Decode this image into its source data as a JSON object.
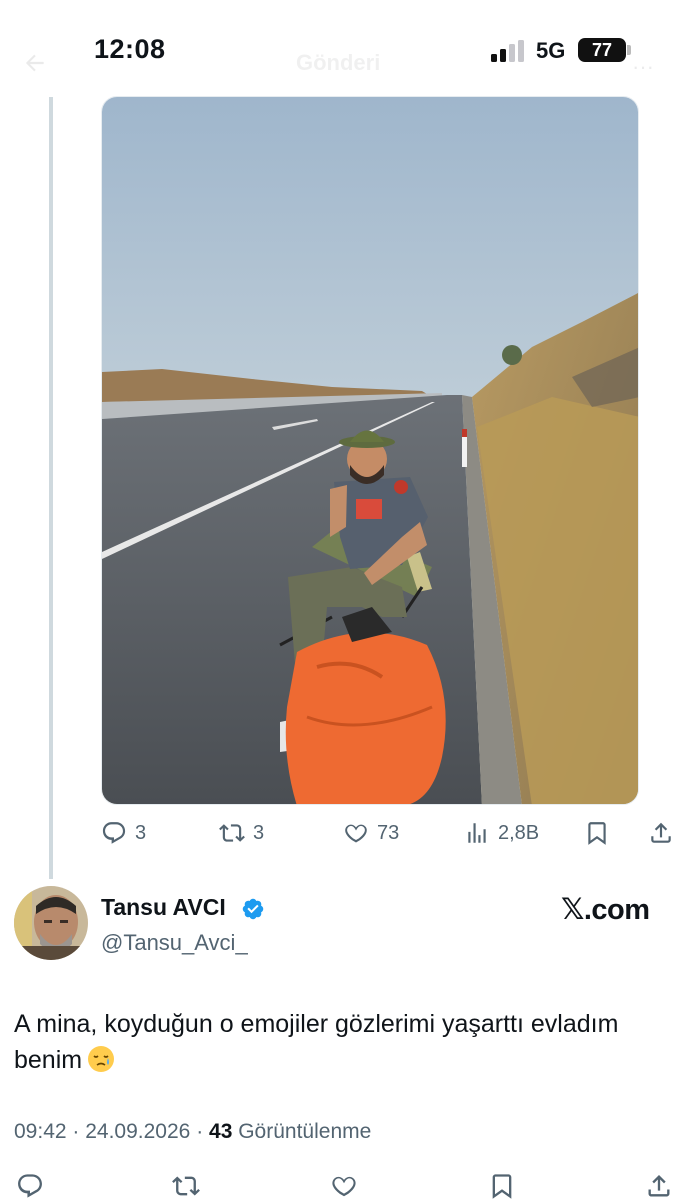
{
  "status_bar": {
    "time": "12:08",
    "network": "5G",
    "battery": "77"
  },
  "header": {
    "title": "Gönderi"
  },
  "media": {
    "alt": "Man in hat sitting on a folding chair beside a highway with an orange bag"
  },
  "actions": {
    "reply_count": "3",
    "retweet_count": "3",
    "like_count": "73",
    "view_count": "2,8B"
  },
  "quote": {
    "author_name": "Tansu AVCI",
    "handle": "@Tansu_Avci_",
    "brand": "𝕏.com",
    "text": "A mina, koyduğun o emojiler gözlerimi yaşarttı evladım benim",
    "emoji": "crying-face-icon",
    "time": "09:42",
    "date": "24.09.2026",
    "views_count": "43",
    "views_label": "Görüntülenme"
  },
  "colors": {
    "accent": "#1d9bf0",
    "text_secondary": "#536471",
    "thread_line": "#cfd9de"
  }
}
